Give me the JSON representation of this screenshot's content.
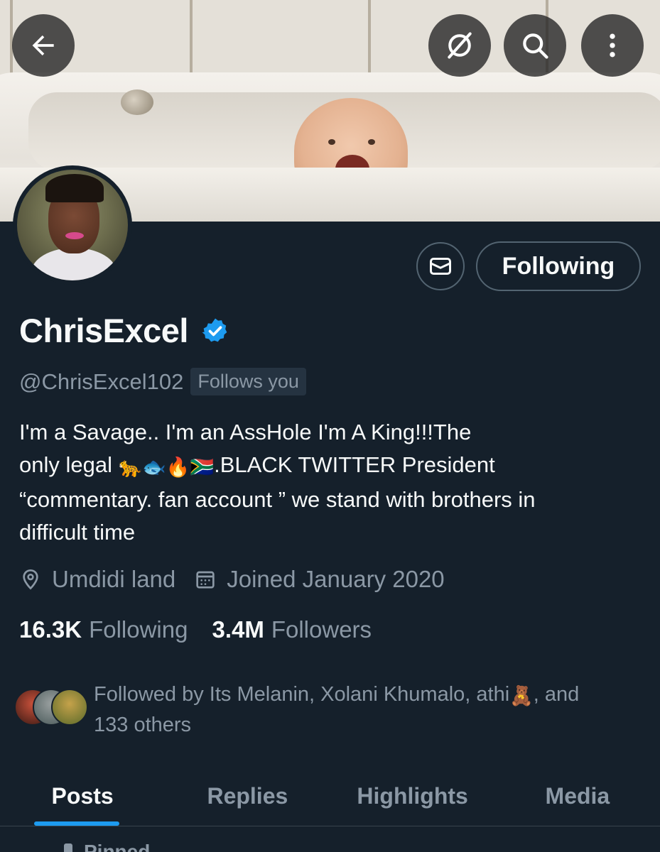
{
  "header": {
    "back_icon": "arrow-left-icon",
    "grok_icon": "grok-icon",
    "search_icon": "search-icon",
    "more_icon": "more-vertical-icon"
  },
  "profile": {
    "display_name": "ChrisExcel",
    "handle": "@ChrisExcel102",
    "follows_you": "Follows you",
    "verified": true,
    "bio_line1": "I'm a Savage.. I'm an AssHole I'm A King!!!The",
    "bio_line2_prefix": "only legal ",
    "bio_emojis": [
      "🐆",
      "🐟",
      "🔥",
      "🇿🇦"
    ],
    "bio_line2_suffix": ".BLACK TWITTER President",
    "bio_line3": "“commentary. fan account ” we stand with brothers in",
    "bio_line4": "difficult time",
    "location": "Umdidi land",
    "joined": "Joined January 2020",
    "following_count": "16.3K",
    "following_label": "Following",
    "followers_count": "3.4M",
    "followers_label": "Followers",
    "followed_by_text": "Followed by Its Melanin, Xolani Khumalo, athi",
    "followed_by_emoji": "🧸",
    "followed_by_tail": ", and",
    "followed_by_line2": "133 others"
  },
  "actions": {
    "message_icon": "mail-icon",
    "follow_label": "Following"
  },
  "tabs": [
    {
      "label": "Posts",
      "active": true
    },
    {
      "label": "Replies",
      "active": false
    },
    {
      "label": "Highlights",
      "active": false
    },
    {
      "label": "Media",
      "active": false
    }
  ],
  "pinned_label": "Pinned",
  "colors": {
    "background": "#15202b",
    "accent": "#1d9bf0",
    "secondary_text": "#8b98a5",
    "verified_badge": "#1d9bf0"
  }
}
